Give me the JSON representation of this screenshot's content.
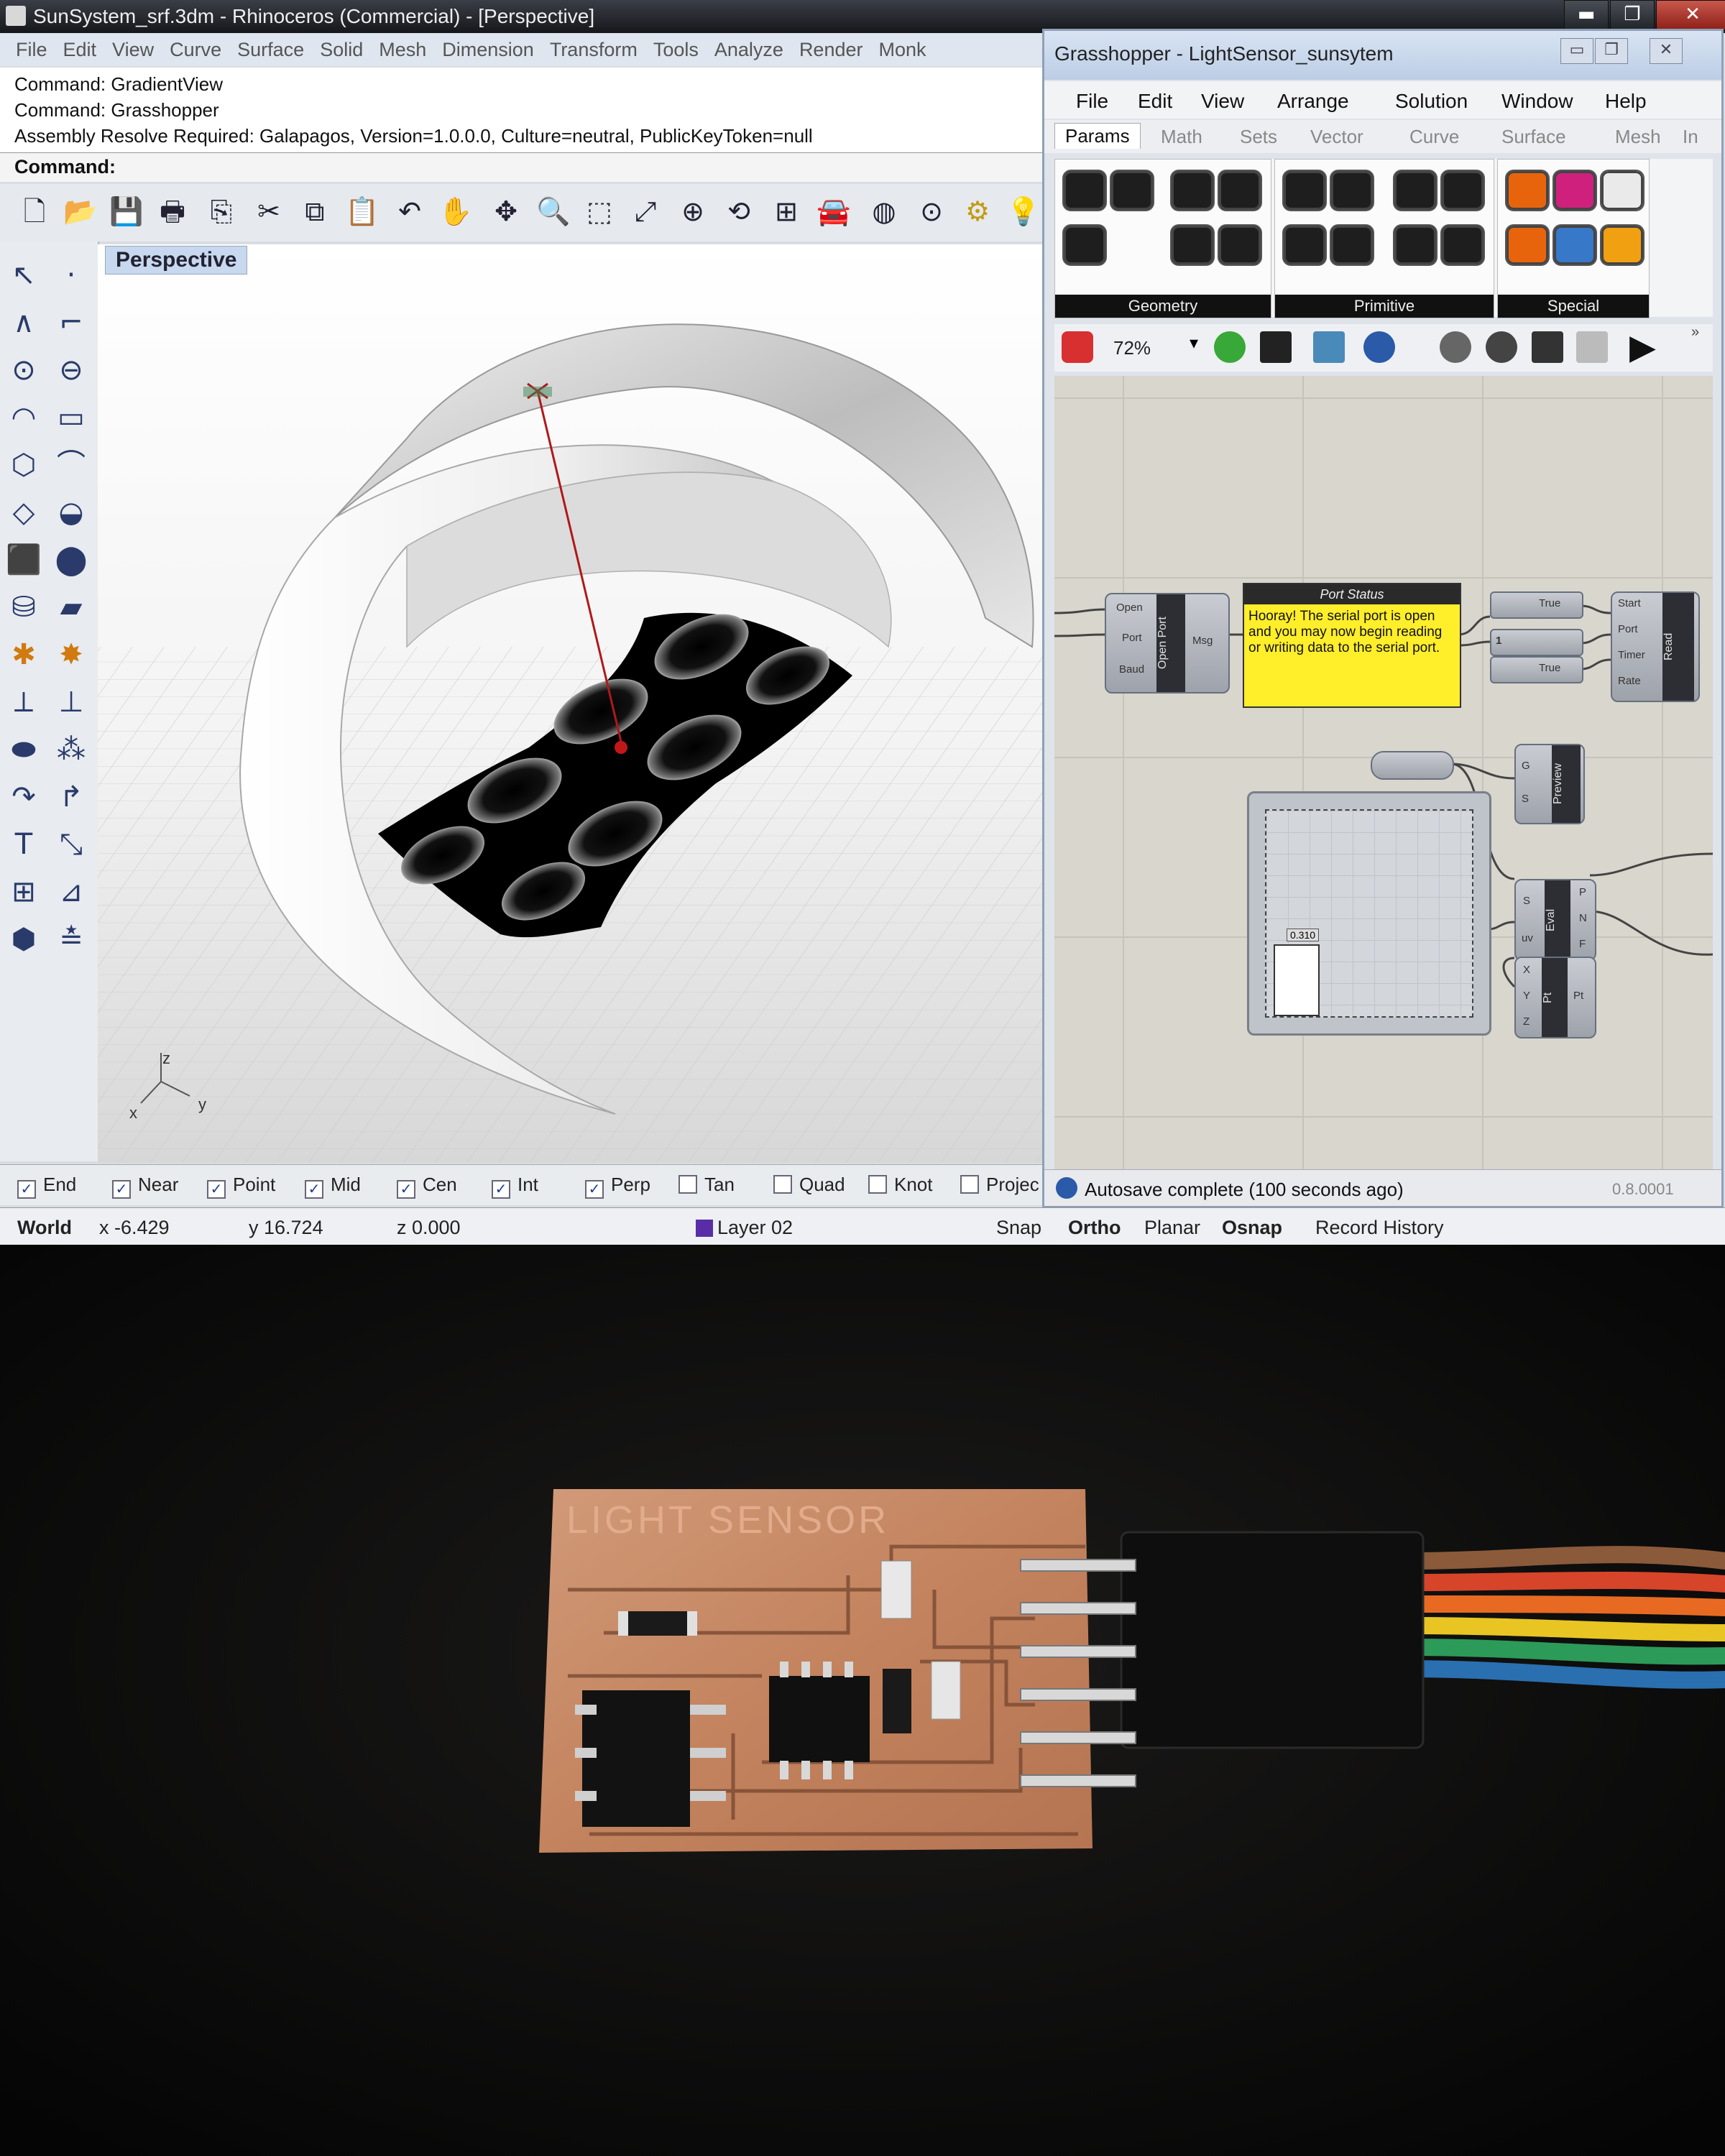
{
  "rhino": {
    "title": "SunSystem_srf.3dm - Rhinoceros (Commercial) - [Perspective]",
    "menu": [
      "File",
      "Edit",
      "View",
      "Curve",
      "Surface",
      "Solid",
      "Mesh",
      "Dimension",
      "Transform",
      "Tools",
      "Analyze",
      "Render",
      "Monk"
    ],
    "command_history": [
      "Command: GradientView",
      "Command: Grasshopper",
      "Assembly Resolve Required: Galapagos, Version=1.0.0.0, Culture=neutral, PublicKeyToken=null"
    ],
    "command_prompt": "Command:",
    "viewport_label": "Perspective",
    "axes": {
      "z": "z",
      "x": "x",
      "y": "y"
    },
    "osnaps": [
      {
        "label": "End",
        "checked": true
      },
      {
        "label": "Near",
        "checked": true
      },
      {
        "label": "Point",
        "checked": true
      },
      {
        "label": "Mid",
        "checked": true
      },
      {
        "label": "Cen",
        "checked": true
      },
      {
        "label": "Int",
        "checked": true
      },
      {
        "label": "Perp",
        "checked": true
      },
      {
        "label": "Tan",
        "checked": false
      },
      {
        "label": "Quad",
        "checked": false
      },
      {
        "label": "Knot",
        "checked": false
      },
      {
        "label": "Projec",
        "checked": false
      }
    ],
    "status": {
      "cplane": "World",
      "x": "x -6.429",
      "y": "y 16.724",
      "z": "z 0.000",
      "layer": "Layer 02",
      "layer_color": "#5a2da8",
      "snap": "Snap",
      "ortho": "Ortho",
      "planar": "Planar",
      "osnap": "Osnap",
      "record": "Record History"
    }
  },
  "grasshopper": {
    "title": "Grasshopper - LightSensor_sunsytem",
    "menu": [
      "File",
      "Edit",
      "View",
      "Arrange",
      "Solution",
      "Window",
      "Help"
    ],
    "tabs": [
      "Params",
      "Math",
      "Sets",
      "Vector",
      "Curve",
      "Surface",
      "Mesh",
      "In"
    ],
    "active_tab": "Params",
    "groups": [
      "Geometry",
      "Primitive",
      "Special"
    ],
    "zoom": "72%",
    "panel_title": "Port Status",
    "panel_text": "Hooray! The serial port is open and you may now begin reading or writing data to the serial port.",
    "open_port": {
      "name": "Open Port",
      "inputs": [
        "Open",
        "Port",
        "Baud"
      ],
      "output": "Msg"
    },
    "toggles": [
      "True",
      "1",
      "True"
    ],
    "read": {
      "name": "Read",
      "inputs": [
        "Start",
        "Port",
        "Timer",
        "Rate"
      ]
    },
    "preview": {
      "name": "Preview",
      "inputs": [
        "G",
        "S"
      ]
    },
    "eval": {
      "name": "Eval",
      "inputs": [
        "S",
        "uv"
      ],
      "outputs": [
        "P",
        "N",
        "F"
      ]
    },
    "pt": {
      "name": "Pt",
      "inputs": [
        "X",
        "Y",
        "Z"
      ],
      "output": "Pt"
    },
    "graph_value": "0.310",
    "autosave": "Autosave complete (100 seconds ago)",
    "version": "0.8.0001"
  },
  "photo": {
    "board_label": "LIGHT SENSOR",
    "pcb_color": "#c98a64",
    "wire_colors": [
      "#8a5a3a",
      "#d6452a",
      "#e86a22",
      "#e8c522",
      "#2c9a58",
      "#2a6fb0"
    ]
  }
}
